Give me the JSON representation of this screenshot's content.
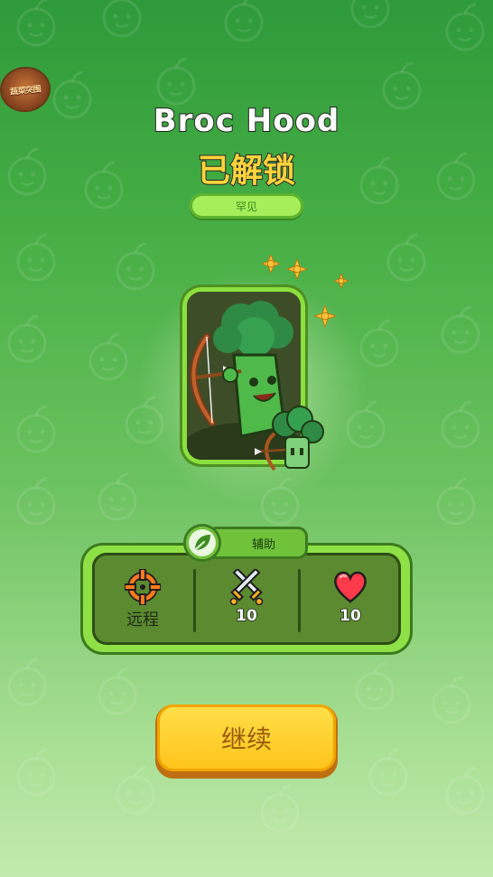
{
  "logo": {
    "text": "蔬菜突围"
  },
  "hero": {
    "name": "Broc Hood",
    "status": "已解锁",
    "rarity": "罕见"
  },
  "role": {
    "label": "辅助",
    "icon": "leaf-icon"
  },
  "stats": [
    {
      "icon": "crosshair-icon",
      "label": "远程"
    },
    {
      "icon": "crossed-swords-icon",
      "label": "10"
    },
    {
      "icon": "heart-icon",
      "label": "10"
    }
  ],
  "buttons": {
    "continue_label": "继续"
  },
  "colors": {
    "background_top": "#2f9a3a",
    "background_bottom": "#c2eaae",
    "accent_green": "#8be03f",
    "title_yellow": "#ffd43a",
    "button_yellow": "#ffc21a"
  }
}
